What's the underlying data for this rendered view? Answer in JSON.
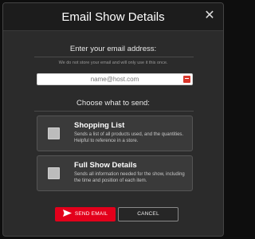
{
  "dialog": {
    "title": "Email Show Details",
    "close_glyph": "✕"
  },
  "email": {
    "label": "Enter your email address:",
    "note": "We do not store your email and will only use it this once.",
    "placeholder": "name@host.com",
    "value": ""
  },
  "send_section": {
    "label": "Choose what to send:",
    "options": [
      {
        "title": "Shopping List",
        "description": "Sends a list of all products used, and the quantities. Helpful to reference in a store.",
        "checked": false
      },
      {
        "title": "Full Show Details",
        "description": "Sends all information needed for the show, including the time and position of each item.",
        "checked": false
      }
    ]
  },
  "buttons": {
    "send_label": "SEND EMAIL",
    "cancel_label": "CANCEL"
  },
  "colors": {
    "accent": "#e3001b",
    "panel": "#2b2b2b",
    "header": "#1c1c1c"
  },
  "icons": {
    "close": "close-icon",
    "send": "paper-plane-icon",
    "input_badge": "autofill-icon"
  }
}
